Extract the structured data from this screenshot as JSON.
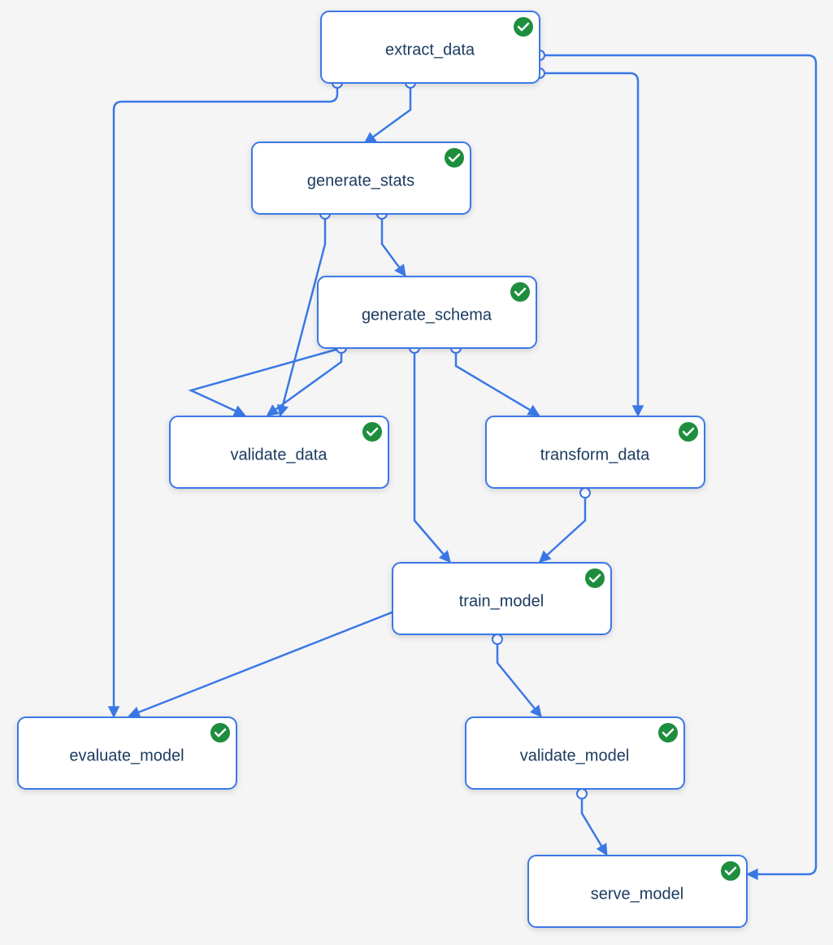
{
  "diagram": {
    "type": "dag-pipeline",
    "label_color": "#1a3a5f",
    "edge_color": "#3b78e7",
    "background": "#f5f5f5",
    "nodes": {
      "extract_data": {
        "label": "extract_data",
        "status": "success"
      },
      "generate_stats": {
        "label": "generate_stats",
        "status": "success"
      },
      "generate_schema": {
        "label": "generate_schema",
        "status": "success"
      },
      "validate_data": {
        "label": "validate_data",
        "status": "success"
      },
      "transform_data": {
        "label": "transform_data",
        "status": "success"
      },
      "train_model": {
        "label": "train_model",
        "status": "success"
      },
      "evaluate_model": {
        "label": "evaluate_model",
        "status": "success"
      },
      "validate_model": {
        "label": "validate_model",
        "status": "success"
      },
      "serve_model": {
        "label": "serve_model",
        "status": "success"
      }
    },
    "edges": [
      {
        "from": "extract_data",
        "to": "generate_stats"
      },
      {
        "from": "extract_data",
        "to": "evaluate_model"
      },
      {
        "from": "extract_data",
        "to": "transform_data"
      },
      {
        "from": "extract_data",
        "to": "serve_model"
      },
      {
        "from": "generate_stats",
        "to": "generate_schema"
      },
      {
        "from": "generate_stats",
        "to": "validate_data"
      },
      {
        "from": "generate_schema",
        "to": "validate_data"
      },
      {
        "from": "generate_schema",
        "to": "transform_data"
      },
      {
        "from": "generate_schema",
        "to": "train_model"
      },
      {
        "from": "transform_data",
        "to": "train_model"
      },
      {
        "from": "train_model",
        "to": "evaluate_model"
      },
      {
        "from": "train_model",
        "to": "validate_model"
      },
      {
        "from": "validate_model",
        "to": "serve_model"
      }
    ]
  }
}
